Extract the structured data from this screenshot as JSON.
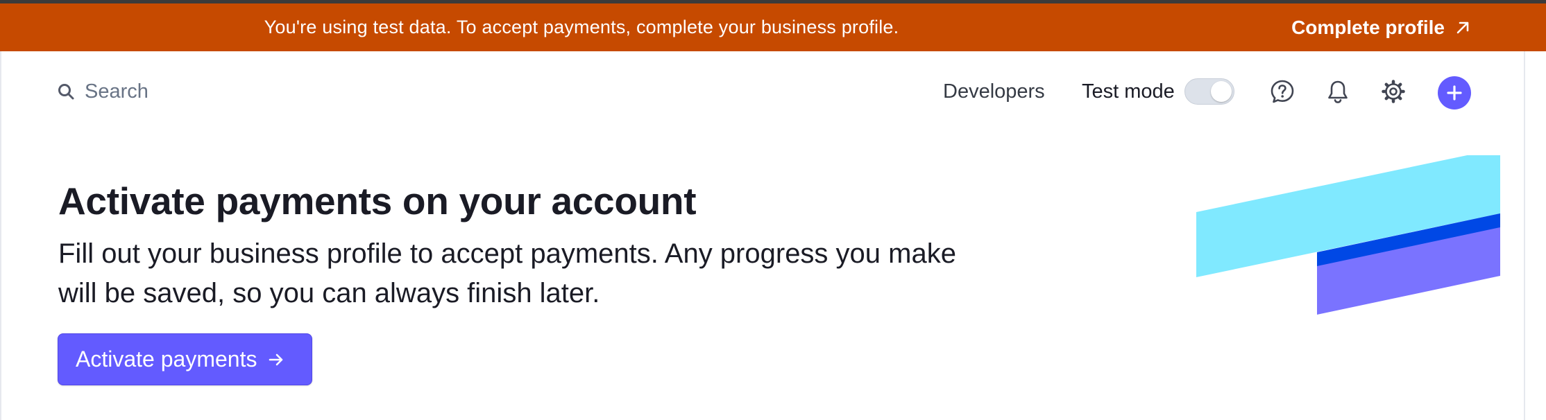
{
  "banner": {
    "message": "You're using test data. To accept payments, complete your business profile.",
    "link_label": "Complete profile",
    "link_icon": "arrow-up-right-icon",
    "background": "#c64a00"
  },
  "header": {
    "search": {
      "placeholder": "Search",
      "icon": "search-icon"
    },
    "developers_label": "Developers",
    "test_mode": {
      "label": "Test mode",
      "enabled": false
    },
    "icons": [
      "help-icon",
      "bell-icon",
      "gear-icon",
      "plus-icon"
    ],
    "accent": "#635bff"
  },
  "hero": {
    "title": "Activate payments on your account",
    "description": "Fill out your business profile to accept payments. Any progress you make will be saved, so you can always finish later.",
    "cta_label": "Activate payments",
    "cta_icon": "arrow-right-icon"
  },
  "illustration": {
    "colors": [
      "#80e9ff",
      "#0048e5",
      "#7a73ff"
    ]
  }
}
